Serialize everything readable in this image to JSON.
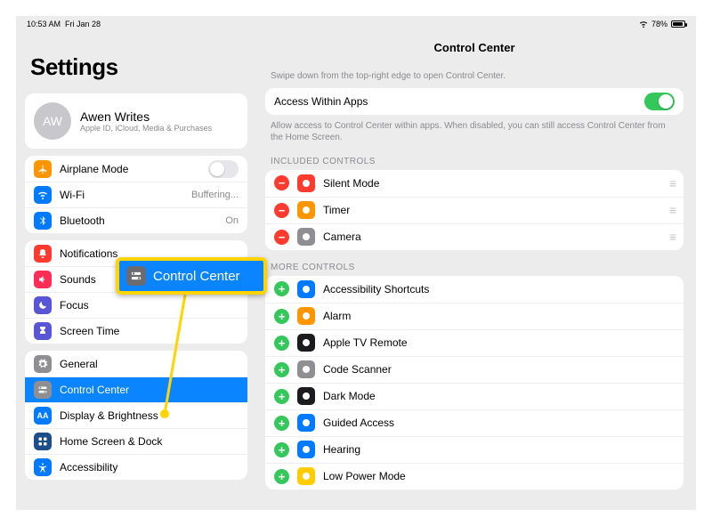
{
  "status": {
    "time": "10:53 AM",
    "date": "Fri Jan 28",
    "battery_pct": "78%"
  },
  "sidebar": {
    "title": "Settings",
    "account": {
      "initials": "AW",
      "name": "Awen Writes",
      "sub": "Apple ID, iCloud, Media & Purchases"
    },
    "g1": [
      {
        "label": "Airplane Mode",
        "kind": "switch",
        "on": false
      },
      {
        "label": "Wi-Fi",
        "value": "Buffering..."
      },
      {
        "label": "Bluetooth",
        "value": "On"
      }
    ],
    "g2": [
      {
        "label": "Notifications"
      },
      {
        "label": "Sounds"
      },
      {
        "label": "Focus"
      },
      {
        "label": "Screen Time"
      }
    ],
    "g3": [
      {
        "label": "General"
      },
      {
        "label": "Control Center",
        "selected": true
      },
      {
        "label": "Display & Brightness"
      },
      {
        "label": "Home Screen & Dock"
      },
      {
        "label": "Accessibility"
      }
    ]
  },
  "detail": {
    "title": "Control Center",
    "hint1": "Swipe down from the top-right edge to open Control Center.",
    "access": {
      "label": "Access Within Apps",
      "on": true
    },
    "hint2": "Allow access to Control Center within apps. When disabled, you can still access Control Center from the Home Screen.",
    "included_label": "INCLUDED CONTROLS",
    "included": [
      {
        "label": "Silent Mode",
        "color": "#ff3b30"
      },
      {
        "label": "Timer",
        "color": "#ff9500"
      },
      {
        "label": "Camera",
        "color": "#8e8e93"
      }
    ],
    "more_label": "MORE CONTROLS",
    "more": [
      {
        "label": "Accessibility Shortcuts",
        "color": "#007aff"
      },
      {
        "label": "Alarm",
        "color": "#ff9500"
      },
      {
        "label": "Apple TV Remote",
        "color": "#1c1c1e"
      },
      {
        "label": "Code Scanner",
        "color": "#8e8e93"
      },
      {
        "label": "Dark Mode",
        "color": "#1c1c1e"
      },
      {
        "label": "Guided Access",
        "color": "#007aff"
      },
      {
        "label": "Hearing",
        "color": "#007aff"
      },
      {
        "label": "Low Power Mode",
        "color": "#ffcc00"
      }
    ]
  },
  "callout": {
    "label": "Control Center"
  }
}
